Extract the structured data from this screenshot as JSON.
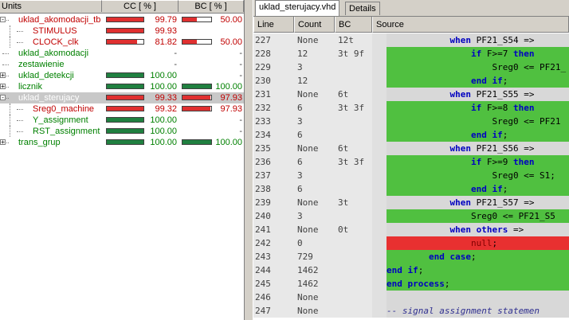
{
  "left_panel": {
    "headers": {
      "units": "Units",
      "cc": "CC [ % ]",
      "bc": "BC [ % ]"
    },
    "units": [
      {
        "name": "uklad_akomodacji_tb",
        "cc": "99.79",
        "cc_pct": 99.79,
        "cc_color": "#e03030",
        "bc": "50.00",
        "bc_pct": 50,
        "bc_color": "#e03030",
        "text_color": "#c00000"
      },
      {
        "name": "STIMULUS",
        "cc": "99.93",
        "cc_pct": 99.93,
        "cc_color": "#e03030",
        "bc": "",
        "bc_pct": null,
        "text_color": "#c00000"
      },
      {
        "name": "CLOCK_clk",
        "cc": "81.82",
        "cc_pct": 81.82,
        "cc_color": "#e03030",
        "bc": "50.00",
        "bc_pct": 50,
        "bc_color": "#e03030",
        "text_color": "#c00000"
      },
      {
        "name": "uklad_akomodacji",
        "cc": "-",
        "bc": "-",
        "text_color": "#008000"
      },
      {
        "name": "zestawienie",
        "cc": "-",
        "bc": "-",
        "text_color": "#008000"
      },
      {
        "name": "uklad_detekcji",
        "cc": "100.00",
        "cc_pct": 100,
        "cc_color": "#208040",
        "bc": "-",
        "text_color": "#008000"
      },
      {
        "name": "licznik",
        "cc": "100.00",
        "cc_pct": 100,
        "cc_color": "#208040",
        "bc": "100.00",
        "bc_pct": 100,
        "bc_color": "#208040",
        "text_color": "#008000"
      },
      {
        "name": "uklad_sterujacy",
        "cc": "99.33",
        "cc_pct": 99.33,
        "cc_color": "#e03030",
        "bc": "97.93",
        "bc_pct": 97.93,
        "bc_color": "#e03030",
        "text_color": "#ffffff",
        "selected": true
      },
      {
        "name": "Sreg0_machine",
        "cc": "99.32",
        "cc_pct": 99.32,
        "cc_color": "#e03030",
        "bc": "97.93",
        "bc_pct": 97.93,
        "bc_color": "#e03030",
        "text_color": "#c00000"
      },
      {
        "name": "Y_assignment",
        "cc": "100.00",
        "cc_pct": 100,
        "cc_color": "#208040",
        "bc": "-",
        "text_color": "#008000"
      },
      {
        "name": "RST_assignment",
        "cc": "100.00",
        "cc_pct": 100,
        "cc_color": "#208040",
        "bc": "-",
        "text_color": "#008000"
      },
      {
        "name": "trans_grup",
        "cc": "100.00",
        "cc_pct": 100,
        "cc_color": "#208040",
        "bc": "100.00",
        "bc_pct": 100,
        "bc_color": "#208040",
        "text_color": "#008000"
      }
    ]
  },
  "right_panel": {
    "tabs": [
      {
        "label": "uklad_sterujacy.vhd",
        "active": true
      },
      {
        "label": "Details",
        "active": false
      }
    ],
    "headers": {
      "line": "Line",
      "count": "Count",
      "bc": "BC",
      "source": "Source"
    },
    "rows": [
      {
        "line": "227",
        "count": "None",
        "bc": "12t",
        "src": "            when PF21_S54 =>",
        "hl": "w"
      },
      {
        "line": "228",
        "count": "12",
        "bc": "3t 9f",
        "src": "                if F>=7 then",
        "hl": "g"
      },
      {
        "line": "229",
        "count": "3",
        "bc": "",
        "src": "                    Sreg0 <= PF21_",
        "hl": "g"
      },
      {
        "line": "230",
        "count": "12",
        "bc": "",
        "src": "                end if;",
        "hl": "g"
      },
      {
        "line": "231",
        "count": "None",
        "bc": "6t",
        "src": "            when PF21_S55 =>",
        "hl": "w"
      },
      {
        "line": "232",
        "count": "6",
        "bc": "3t 3f",
        "src": "                if F>=8 then",
        "hl": "g"
      },
      {
        "line": "233",
        "count": "3",
        "bc": "",
        "src": "                    Sreg0 <= PF21",
        "hl": "g"
      },
      {
        "line": "234",
        "count": "6",
        "bc": "",
        "src": "                end if;",
        "hl": "g"
      },
      {
        "line": "235",
        "count": "None",
        "bc": "6t",
        "src": "            when PF21_S56 =>",
        "hl": "w"
      },
      {
        "line": "236",
        "count": "6",
        "bc": "3t 3f",
        "src": "                if F>=9 then",
        "hl": "g"
      },
      {
        "line": "237",
        "count": "3",
        "bc": "",
        "src": "                    Sreg0 <= S1;",
        "hl": "g"
      },
      {
        "line": "238",
        "count": "6",
        "bc": "",
        "src": "                end if;",
        "hl": "g"
      },
      {
        "line": "239",
        "count": "None",
        "bc": "3t",
        "src": "            when PF21_S57 =>",
        "hl": "w"
      },
      {
        "line": "240",
        "count": "3",
        "bc": "",
        "src": "                Sreg0 <= PF21_S5",
        "hl": "g"
      },
      {
        "line": "241",
        "count": "None",
        "bc": "0t",
        "src": "            when others =>",
        "hl": "w"
      },
      {
        "line": "242",
        "count": "0",
        "bc": "",
        "src": "                null;",
        "hl": "r"
      },
      {
        "line": "243",
        "count": "729",
        "bc": "",
        "src": "        end case;",
        "hl": "g"
      },
      {
        "line": "244",
        "count": "1462",
        "bc": "",
        "src": "end if;",
        "hl": "g"
      },
      {
        "line": "245",
        "count": "1462",
        "bc": "",
        "src": "end process;",
        "hl": "g"
      },
      {
        "line": "246",
        "count": "None",
        "bc": "",
        "src": "",
        "hl": "w"
      },
      {
        "line": "247",
        "count": "None",
        "bc": "",
        "src": "-- signal assignment statemen",
        "hl": "w"
      }
    ]
  }
}
